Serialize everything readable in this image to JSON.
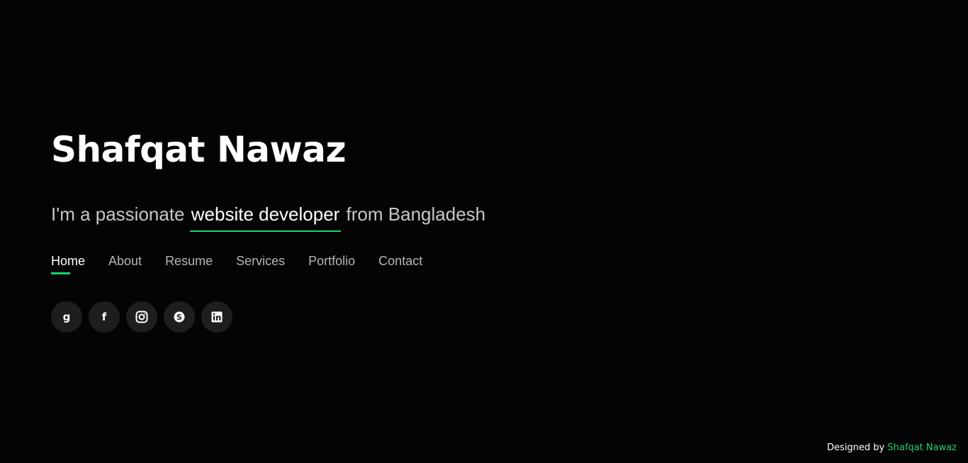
{
  "hero": {
    "name": "Shafqat Nawaz",
    "tagline_prefix": "I'm a passionate ",
    "tagline_highlight": "website developer",
    "tagline_suffix": " from Bangladesh"
  },
  "nav": {
    "items": [
      {
        "label": "Home",
        "active": true
      },
      {
        "label": "About",
        "active": false
      },
      {
        "label": "Resume",
        "active": false
      },
      {
        "label": "Services",
        "active": false
      },
      {
        "label": "Portfolio",
        "active": false
      },
      {
        "label": "Contact",
        "active": false
      }
    ]
  },
  "socials": [
    {
      "icon": "github-icon"
    },
    {
      "icon": "facebook-icon"
    },
    {
      "icon": "instagram-icon"
    },
    {
      "icon": "skype-icon"
    },
    {
      "icon": "linkedin-icon"
    }
  ],
  "footer": {
    "prefix": "Designed by ",
    "link": "Shafqat Nawaz"
  },
  "colors": {
    "background": "#040404",
    "accent": "#18d26e",
    "muted_text": "#b5b5b5",
    "social_bg": "#1e1e1e"
  }
}
